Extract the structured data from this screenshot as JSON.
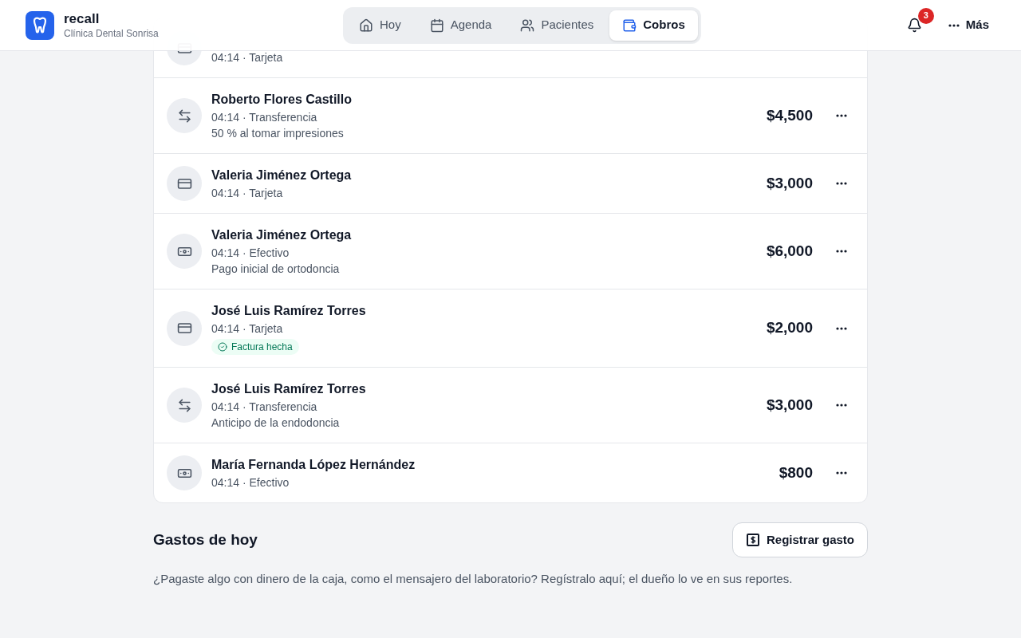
{
  "brand": {
    "name": "recall",
    "clinic": "Clínica Dental Sonrisa"
  },
  "nav": [
    {
      "label": "Hoy",
      "selected": false
    },
    {
      "label": "Agenda",
      "selected": false
    },
    {
      "label": "Pacientes",
      "selected": false
    },
    {
      "label": "Cobros",
      "selected": true
    }
  ],
  "notifications": {
    "count": "3"
  },
  "more": {
    "label": "Más"
  },
  "payments": [
    {
      "meta": "04:14 · Tarjeta",
      "kind": "card"
    },
    {
      "name": "Roberto Flores Castillo",
      "meta": "04:14 · Transferencia",
      "note": "50 % al tomar impresiones",
      "amount": "$4,500",
      "kind": "transfer"
    },
    {
      "name": "Valeria Jiménez Ortega",
      "meta": "04:14 · Tarjeta",
      "amount": "$3,000",
      "kind": "card"
    },
    {
      "name": "Valeria Jiménez Ortega",
      "meta": "04:14 · Efectivo",
      "note": "Pago inicial de ortodoncia",
      "amount": "$6,000",
      "kind": "cash"
    },
    {
      "name": "José Luis Ramírez Torres",
      "meta": "04:14 · Tarjeta",
      "badge": "Factura hecha",
      "amount": "$2,000",
      "kind": "card"
    },
    {
      "name": "José Luis Ramírez Torres",
      "meta": "04:14 · Transferencia",
      "note": "Anticipo de la endodoncia",
      "amount": "$3,000",
      "kind": "transfer"
    },
    {
      "name": "María Fernanda López Hernández",
      "meta": "04:14 · Efectivo",
      "amount": "$800",
      "kind": "cash"
    }
  ],
  "expenses": {
    "title": "Gastos de hoy",
    "button": "Registrar gasto",
    "description": "¿Pagaste algo con dinero de la caja, como el mensajero del laboratorio? Regístralo aquí; el dueño lo ve en sus reportes."
  }
}
